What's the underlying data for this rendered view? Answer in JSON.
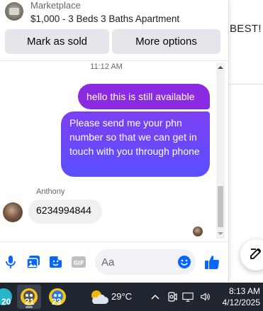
{
  "header": {
    "title": "Marketplace",
    "listing": "$1,000 - 3 Beds 3 Baths Apartment",
    "mark_sold_label": "Mark as sold",
    "more_options_label": "More options"
  },
  "background_page": {
    "text": "BEST!"
  },
  "messages": {
    "timestamp": "11:12 AM",
    "outgoing": [
      "hello this is still available",
      "Please send me your phn number so that we can get in touch with you through phone"
    ],
    "sender_name": "Anthony",
    "incoming": "6234994844"
  },
  "composer": {
    "placeholder": "Aa",
    "icons": [
      "microphone-icon",
      "photo-icon",
      "sticker-icon",
      "gif-icon",
      "emoji-icon",
      "thumbs-up-icon"
    ]
  },
  "taskbar": {
    "badges": [
      "20",
      "21",
      "23"
    ],
    "temperature": "29°C",
    "time": "8:13 AM",
    "date": "4/12/2025"
  },
  "colors": {
    "accent_blue": "#0866ff",
    "bubble_purple": "#8a2be2",
    "bubble_gradient_end": "#5a50ff",
    "taskbar": "#1f2630"
  }
}
